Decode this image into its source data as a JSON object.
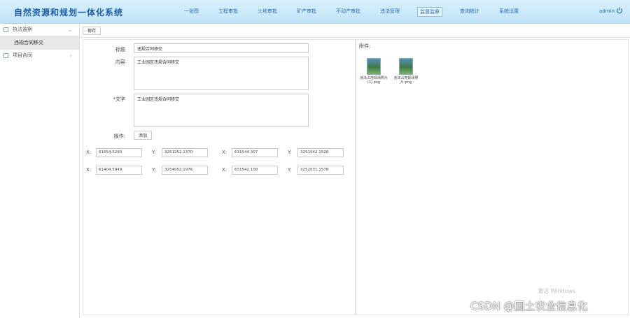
{
  "header": {
    "title": "自然资源和规划一体化系统",
    "nav": [
      {
        "label": "一张图",
        "active": false
      },
      {
        "label": "工程审批",
        "active": false
      },
      {
        "label": "土地审批",
        "active": false
      },
      {
        "label": "矿产审批",
        "active": false
      },
      {
        "label": "不动产审批",
        "active": false
      },
      {
        "label": "违法管理",
        "active": false
      },
      {
        "label": "监督监察",
        "active": true
      },
      {
        "label": "查询统计",
        "active": false
      },
      {
        "label": "系统设置",
        "active": false
      }
    ],
    "user": "admin"
  },
  "sidebar": {
    "items": [
      {
        "label": "执法监察",
        "expanded": true,
        "children": [
          {
            "label": "违规合同移交"
          }
        ]
      },
      {
        "label": "项目合同",
        "expanded": false,
        "children": []
      }
    ]
  },
  "toolbar": {
    "save_label": "保存"
  },
  "form": {
    "title_label": "标题",
    "title_value": "违规合同移交",
    "content_label": "内容",
    "content_value": "工业园区违规合同移交",
    "remark_label": "*文字",
    "remark_value": "工业园区违规合同移交",
    "op_label": "操作:",
    "op_button": "添加"
  },
  "coordinates": {
    "x_label": "X:",
    "y_label": "Y:",
    "rows": [
      [
        [
          "61554.5290",
          "3251252.1370"
        ],
        [
          "631544.307",
          "3251542.1528"
        ]
      ],
      [
        [
          "61404.5949",
          "3254052.1976"
        ],
        [
          "631542.108",
          "3252031.1578"
        ]
      ]
    ]
  },
  "attachments": {
    "title": "附件:",
    "files": [
      {
        "name": "违法占地现场照片(1).png",
        "icon": "image-file-icon"
      },
      {
        "name": "违法占地现场照片.png",
        "icon": "image-file-icon"
      }
    ]
  },
  "overlay": {
    "watermark": "激活 Windows",
    "csdn": "CSDN @国土农业信息化"
  },
  "colors": {
    "accent": "#2a6cb5",
    "header_bg": "#cbe9f9",
    "title": "#1e5ea8"
  }
}
